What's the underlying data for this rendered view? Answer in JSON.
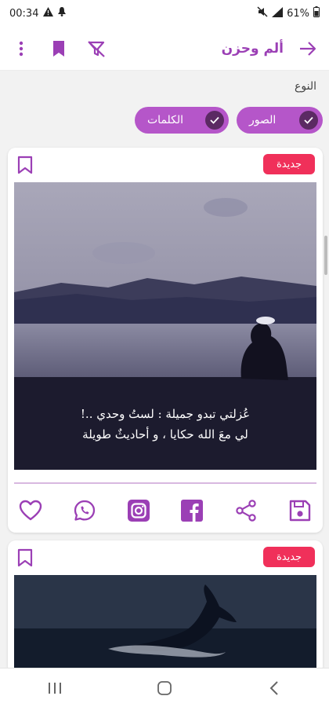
{
  "status_bar": {
    "time": "00:34",
    "battery": "61%"
  },
  "app_bar": {
    "title": "ألم وحزن"
  },
  "filter": {
    "label": "النوع",
    "chips": [
      {
        "label": "الصور",
        "selected": true
      },
      {
        "label": "الكلمات",
        "selected": true
      }
    ]
  },
  "posts": [
    {
      "badge": "جديدة",
      "caption_line1": "عُزلتي تبدو جميلة : لستُ وحدي ..!",
      "caption_line2": "لي معَ الله حكايا ، و أحاديثٌ طويلة"
    },
    {
      "badge": "جديدة"
    }
  ],
  "colors": {
    "accent": "#9b3fb5",
    "chip": "#b556c9",
    "badge": "#f0305a"
  },
  "icons": [
    "back-arrow-icon",
    "filter-off-icon",
    "bookmark-icon",
    "more-vert-icon",
    "check-icon",
    "heart-icon",
    "whatsapp-icon",
    "instagram-icon",
    "facebook-icon",
    "share-icon",
    "save-icon"
  ]
}
